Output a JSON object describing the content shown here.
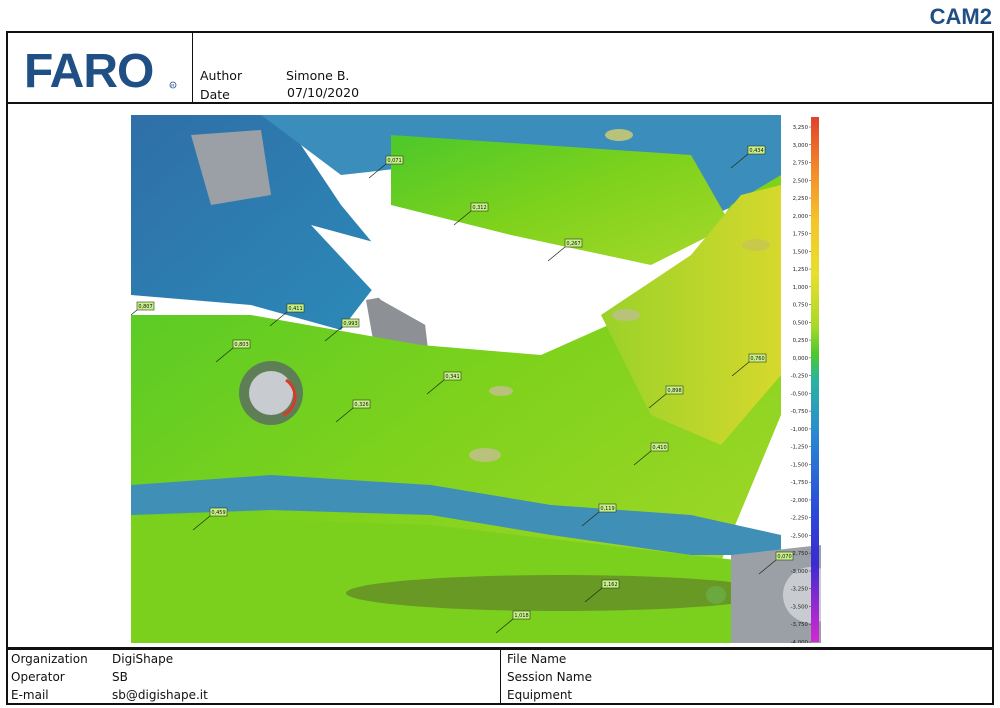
{
  "brand_mark": "CAM2",
  "logo_text": "FARO",
  "header": {
    "author_label": "Author",
    "author_value": "Simone B.",
    "date_label": "Date",
    "date_value": "07/10/2020"
  },
  "footer": {
    "organization_label": "Organization",
    "organization_value": "DigiShape",
    "operator_label": "Operator",
    "operator_value": "SB",
    "email_label": "E-mail",
    "email_value": "sb@digishape.it",
    "file_name_label": "File Name",
    "session_name_label": "Session Name",
    "equipment_label": "Equipment"
  },
  "color_scale": {
    "ticks": [
      "3,250",
      "3,000",
      "2,750",
      "2,500",
      "2,250",
      "2,000",
      "1,750",
      "1,500",
      "1,250",
      "1,000",
      "0,750",
      "0,500",
      "0,250",
      "0,000",
      "-0,250",
      "-0,500",
      "-0,750",
      "-1,000",
      "-1,250",
      "-1,500",
      "-1,750",
      "-2,000",
      "-2,250",
      "-2,500",
      "-2,750",
      "-3,000",
      "-3,250",
      "-3,500",
      "-3,750",
      "-4,000"
    ],
    "colors": [
      "#e0402a",
      "#f28a2a",
      "#f5c52a",
      "#e8e02a",
      "#a8d82a",
      "#4ec82a",
      "#2ab4a0",
      "#2a8ad0",
      "#2a4ad8",
      "#3a2ad0",
      "#8a2ad0",
      "#d02ad0"
    ]
  },
  "callouts": [
    {
      "value": "0,071"
    },
    {
      "value": "0,312"
    },
    {
      "value": "0,267"
    },
    {
      "value": "0,434"
    },
    {
      "value": "0,807"
    },
    {
      "value": "0,411"
    },
    {
      "value": "0,993"
    },
    {
      "value": "0,803"
    },
    {
      "value": "0,341"
    },
    {
      "value": "0,326"
    },
    {
      "value": "0,760"
    },
    {
      "value": "0,898"
    },
    {
      "value": "0,410"
    },
    {
      "value": "0,459"
    },
    {
      "value": "0,119"
    },
    {
      "value": "0,070"
    },
    {
      "value": "1,162"
    },
    {
      "value": "1,018"
    }
  ]
}
